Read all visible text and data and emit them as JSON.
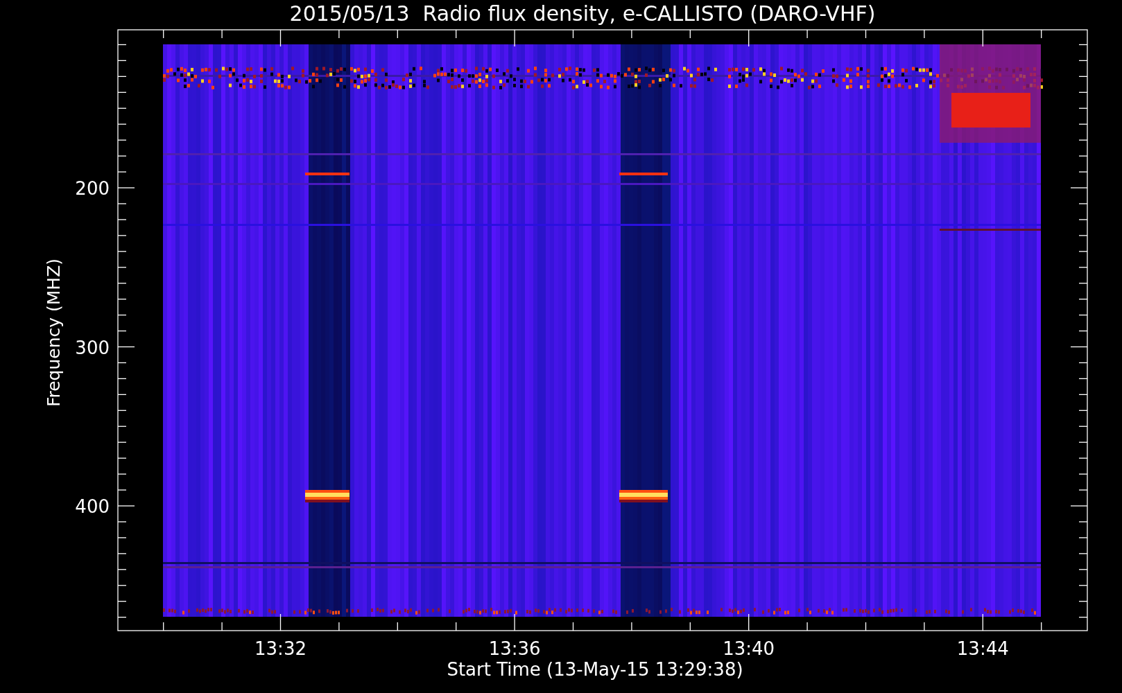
{
  "title": "2015/05/13  Radio flux density, e-CALLISTO (DARO-VHF)",
  "y_axis": {
    "label": "Frequency (MHZ)",
    "ticks": [
      "200",
      "300",
      "400"
    ]
  },
  "x_axis": {
    "label": "Start Time (13-May-15 13:29:38)",
    "ticks": [
      "13:32",
      "13:36",
      "13:40",
      "13:44"
    ]
  }
}
